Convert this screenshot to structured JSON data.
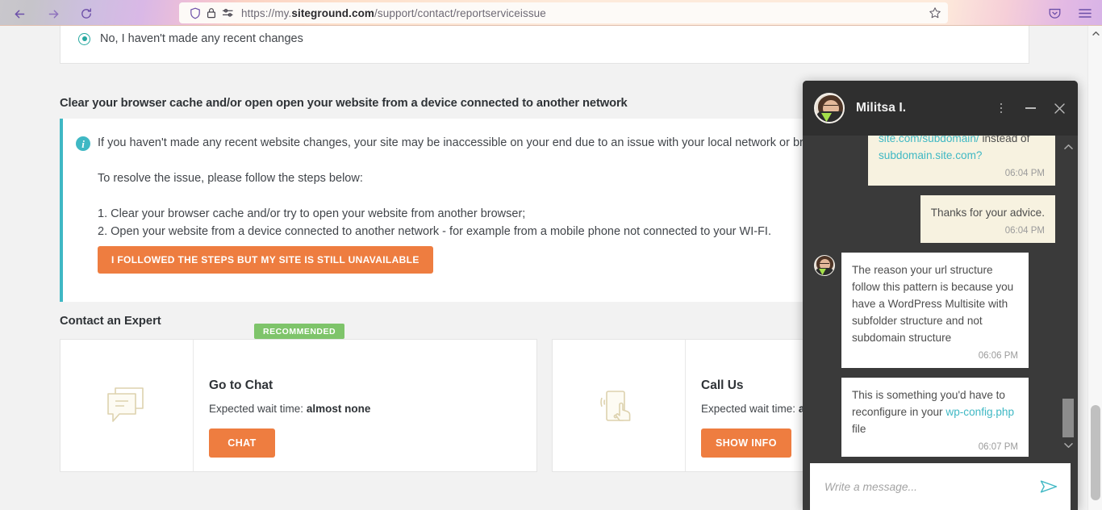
{
  "browser": {
    "back_label": "Back",
    "forward_label": "Forward",
    "reload_label": "Reload",
    "url_prefix": "https://my.",
    "url_domain": "siteground.com",
    "url_path": "/support/contact/reportserviceissue",
    "url_full": "https://my.siteground.com/support/contact/reportserviceissue",
    "shield_icon": "shield-icon",
    "lock_icon": "lock-icon",
    "permissions_icon": "permissions-icon",
    "bookmark_icon": "star-icon",
    "pocket_icon": "pocket-icon",
    "menu_icon": "hamburger-menu-icon"
  },
  "page": {
    "radio_option_label": "No, I haven't made any recent changes",
    "section_heading": "Clear your browser cache and/or open open your website from a device connected to another network",
    "info": {
      "icon": "info-icon",
      "line_1": "If you haven't made any recent website changes, your site may be inaccessible on your end due to an issue with your local network or browser.",
      "line_2": "To resolve the issue, please follow the steps below:",
      "step_1": "1. Clear your browser cache and/or try to open your website from another browser;",
      "step_2": "2. Open your website from a device connected to another network - for example from a mobile phone not connected to your WI-FI.",
      "cta_label": "I FOLLOWED THE STEPS BUT MY SITE IS STILL UNAVAILABLE"
    },
    "contact_heading": "Contact an Expert",
    "recommended_badge": "RECOMMENDED",
    "cards": [
      {
        "icon": "chat-bubble-icon",
        "title": "Go to Chat",
        "wait_prefix": "Expected wait time: ",
        "wait_value": "almost none",
        "cta_label": "CHAT"
      },
      {
        "icon": "phone-tap-icon",
        "title": "Call Us",
        "wait_prefix": "Expected wait time: ",
        "wait_value": "almost none",
        "cta_label": "SHOW INFO"
      }
    ]
  },
  "chat": {
    "agent_name": "Militsa I.",
    "avatar_icon": "agent-avatar",
    "kebab_icon": "kebab-menu-icon",
    "minimize_icon": "minimize-icon",
    "close_icon": "close-icon",
    "scroll_up_icon": "chevron-up-icon",
    "scroll_down_icon": "chevron-down-icon",
    "messages": [
      {
        "direction": "outgoing",
        "link_1": "site.com/subdomain/",
        "text_mid": " instead of ",
        "link_2": "subdomain.site.com?",
        "time": "06:04 PM"
      },
      {
        "direction": "outgoing",
        "text": "Thanks for your advice.",
        "time": "06:04 PM"
      },
      {
        "direction": "incoming",
        "text": "The reason your url structure follow this pattern is because you have a WordPress Multisite with subfolder structure and not subdomain structure",
        "time": "06:06 PM"
      },
      {
        "direction": "incoming",
        "text_before": "This is something you'd have to reconfigure in your ",
        "link": "wp-config.php",
        "text_after": " file",
        "time": "06:07 PM"
      }
    ],
    "input_placeholder": "Write a message...",
    "input_value": "",
    "send_icon": "send-arrow-icon"
  },
  "colors": {
    "accent_orange": "#ee7d40",
    "accent_teal": "#3fb8c4",
    "badge_green": "#7ec46a",
    "chat_dark": "#3a3a3a",
    "chat_header_dark": "#2f2f2f",
    "outgoing_bubble": "#f7f2e0"
  }
}
